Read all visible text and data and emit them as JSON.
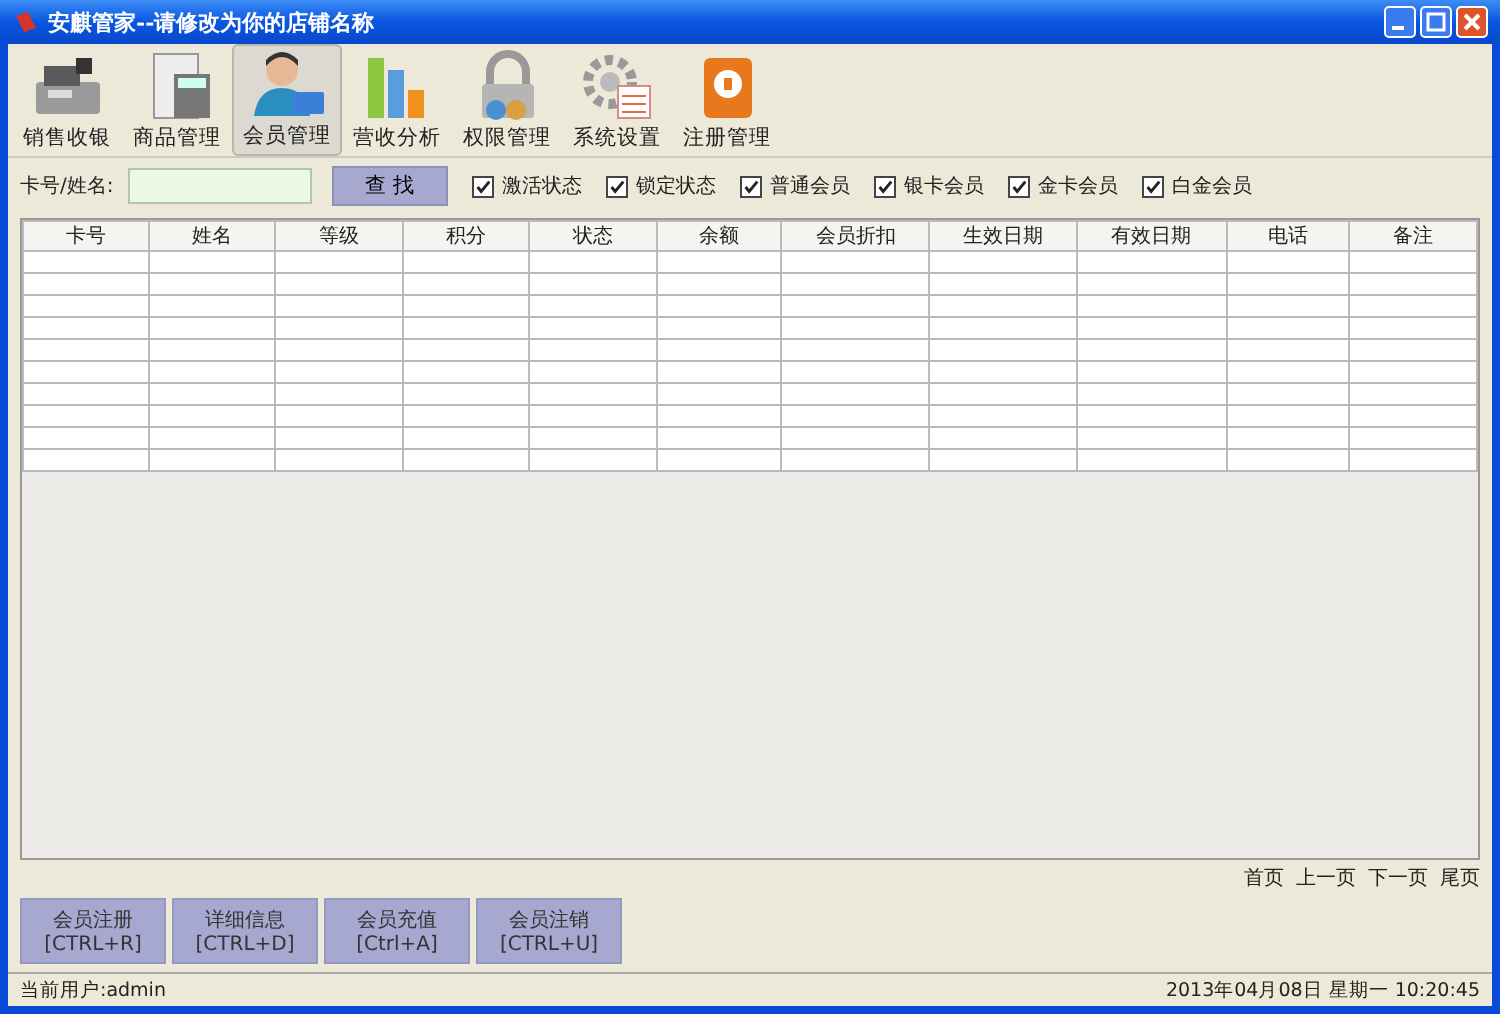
{
  "window": {
    "title": "安麒管家--请修改为你的店铺名称"
  },
  "toolbar": [
    {
      "label": "销售收银",
      "selected": false
    },
    {
      "label": "商品管理",
      "selected": false
    },
    {
      "label": "会员管理",
      "selected": true
    },
    {
      "label": "营收分析",
      "selected": false
    },
    {
      "label": "权限管理",
      "selected": false
    },
    {
      "label": "系统设置",
      "selected": false
    },
    {
      "label": "注册管理",
      "selected": false
    }
  ],
  "search": {
    "label": "卡号/姓名:",
    "button": "查 找"
  },
  "filters": [
    {
      "label": "激活状态",
      "checked": true
    },
    {
      "label": "锁定状态",
      "checked": true
    },
    {
      "label": "普通会员",
      "checked": true
    },
    {
      "label": "银卡会员",
      "checked": true
    },
    {
      "label": "金卡会员",
      "checked": true
    },
    {
      "label": "白金会员",
      "checked": true
    }
  ],
  "table": {
    "columns": [
      "卡号",
      "姓名",
      "等级",
      "积分",
      "状态",
      "余额",
      "会员折扣",
      "生效日期",
      "有效日期",
      "电话",
      "备注"
    ]
  },
  "pager": [
    "首页",
    "上一页",
    "下一页",
    "尾页"
  ],
  "actions": [
    {
      "label": "会员注册",
      "shortcut": "[CTRL+R]"
    },
    {
      "label": "详细信息",
      "shortcut": "[CTRL+D]"
    },
    {
      "label": "会员充值",
      "shortcut": "[Ctrl+A]"
    },
    {
      "label": "会员注销",
      "shortcut": "[CTRL+U]"
    }
  ],
  "status_bar": {
    "user": "当前用户:admin",
    "datetime": "2013年04月08日 星期一 10:20:45"
  }
}
